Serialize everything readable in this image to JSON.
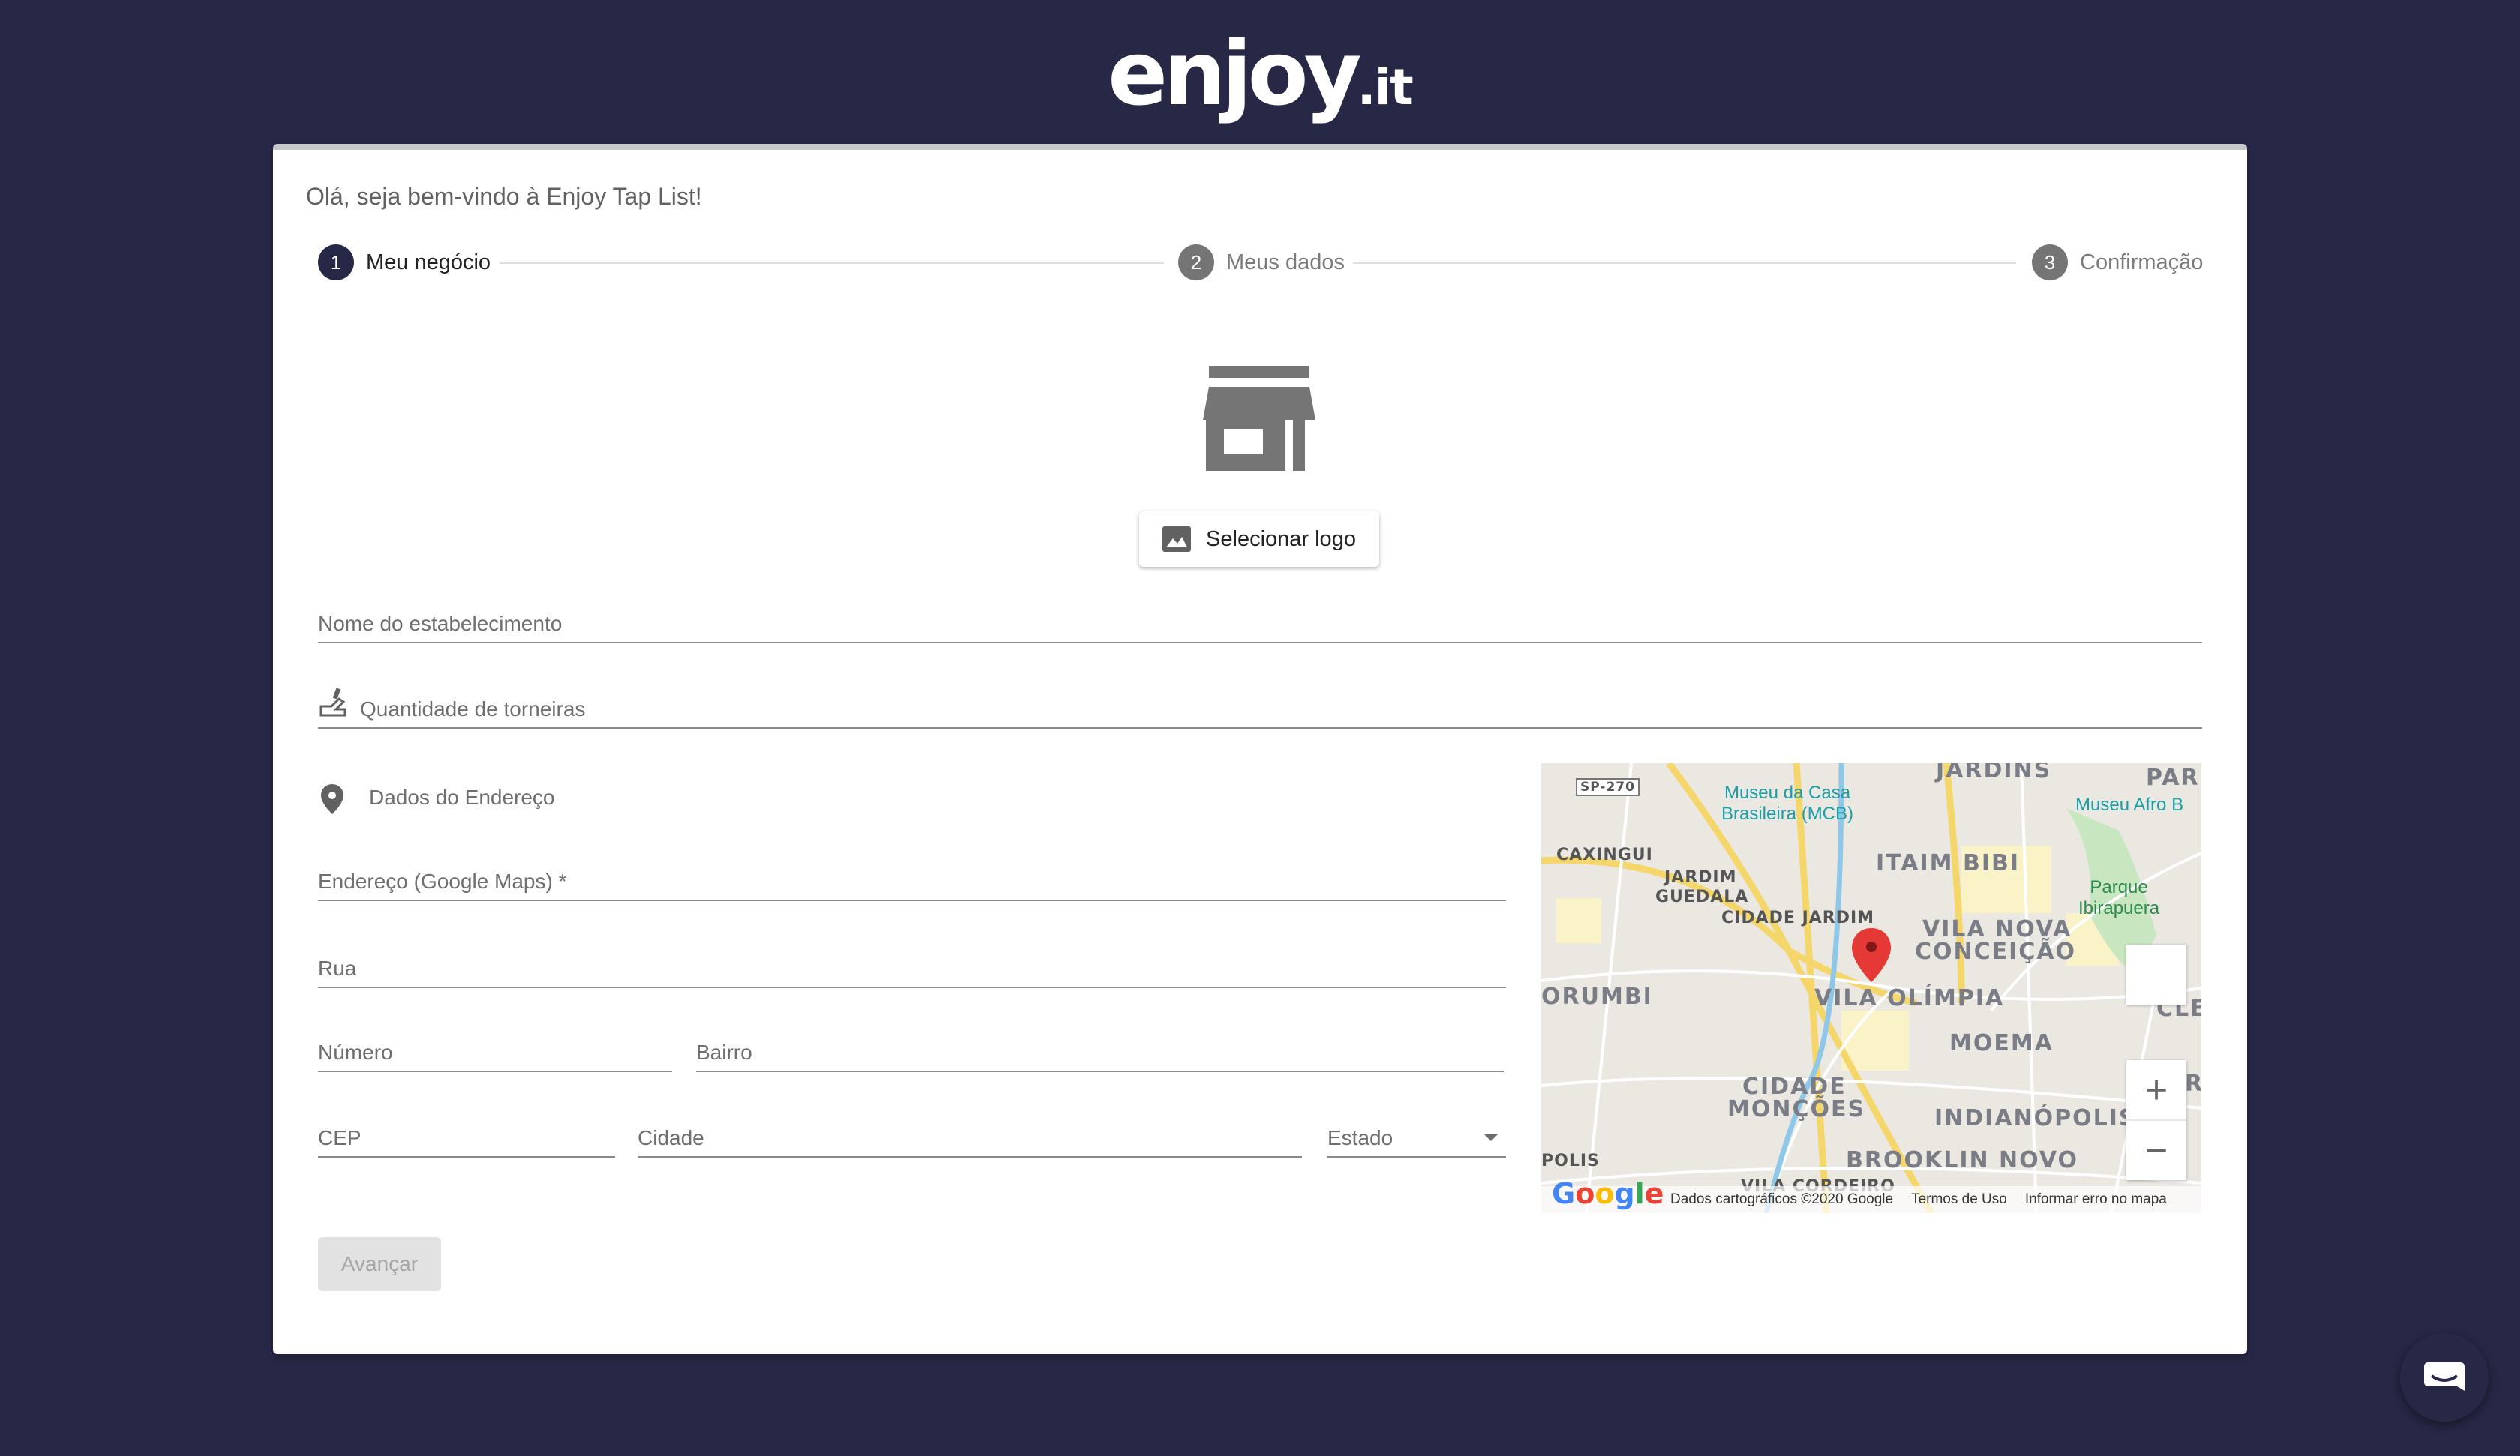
{
  "brand": {
    "name": "enjoy",
    "suffix": ".it"
  },
  "welcome": "Olá, seja bem-vindo à Enjoy Tap List!",
  "steps": [
    {
      "number": "1",
      "label": "Meu negócio",
      "active": true
    },
    {
      "number": "2",
      "label": "Meus dados",
      "active": false
    },
    {
      "number": "3",
      "label": "Confirmação",
      "active": false
    }
  ],
  "logo_button": {
    "label": "Selecionar logo",
    "icon": "image-icon"
  },
  "fields": {
    "name": "Nome do estabelecimento",
    "taps": "Quantidade de torneiras",
    "address_section": "Dados do Endereço",
    "address": "Endereço (Google Maps) *",
    "street": "Rua",
    "number": "Número",
    "neighborhood": "Bairro",
    "cep": "CEP",
    "city": "Cidade",
    "state": "Estado"
  },
  "advance_button": "Avançar",
  "map": {
    "labels": [
      "JARDINS",
      "PAR",
      "ITAIM BIBI",
      "VILA NOVA",
      "CONCEIÇÃO",
      "VILA OLÍMPIA",
      "MOEMA",
      "ORUMBI",
      "CIDADE",
      "MONÇÕES",
      "INDIANÓPOLIS",
      "BROOKLIN NOVO",
      "POLIS",
      "CLE",
      "R",
      "VILA CORDEIRO"
    ],
    "small_labels": [
      "CAXINGUI",
      "JARDIM",
      "GUEDALA",
      "CIDADE JARDIM",
      "SP-270"
    ],
    "pois": [
      "Museu da Casa",
      "Brasileira (MCB)",
      "Museu Afro B"
    ],
    "park": [
      "Parque",
      "Ibirapuera"
    ],
    "zoom_in": "+",
    "zoom_out": "−",
    "google": "Google",
    "footer": {
      "data": "Dados cartográficos ©2020 Google",
      "terms": "Termos de Uso",
      "report": "Informar erro no mapa"
    }
  },
  "colors": {
    "background": "#262846",
    "active_step": "#262846",
    "marker": "#e53935"
  }
}
